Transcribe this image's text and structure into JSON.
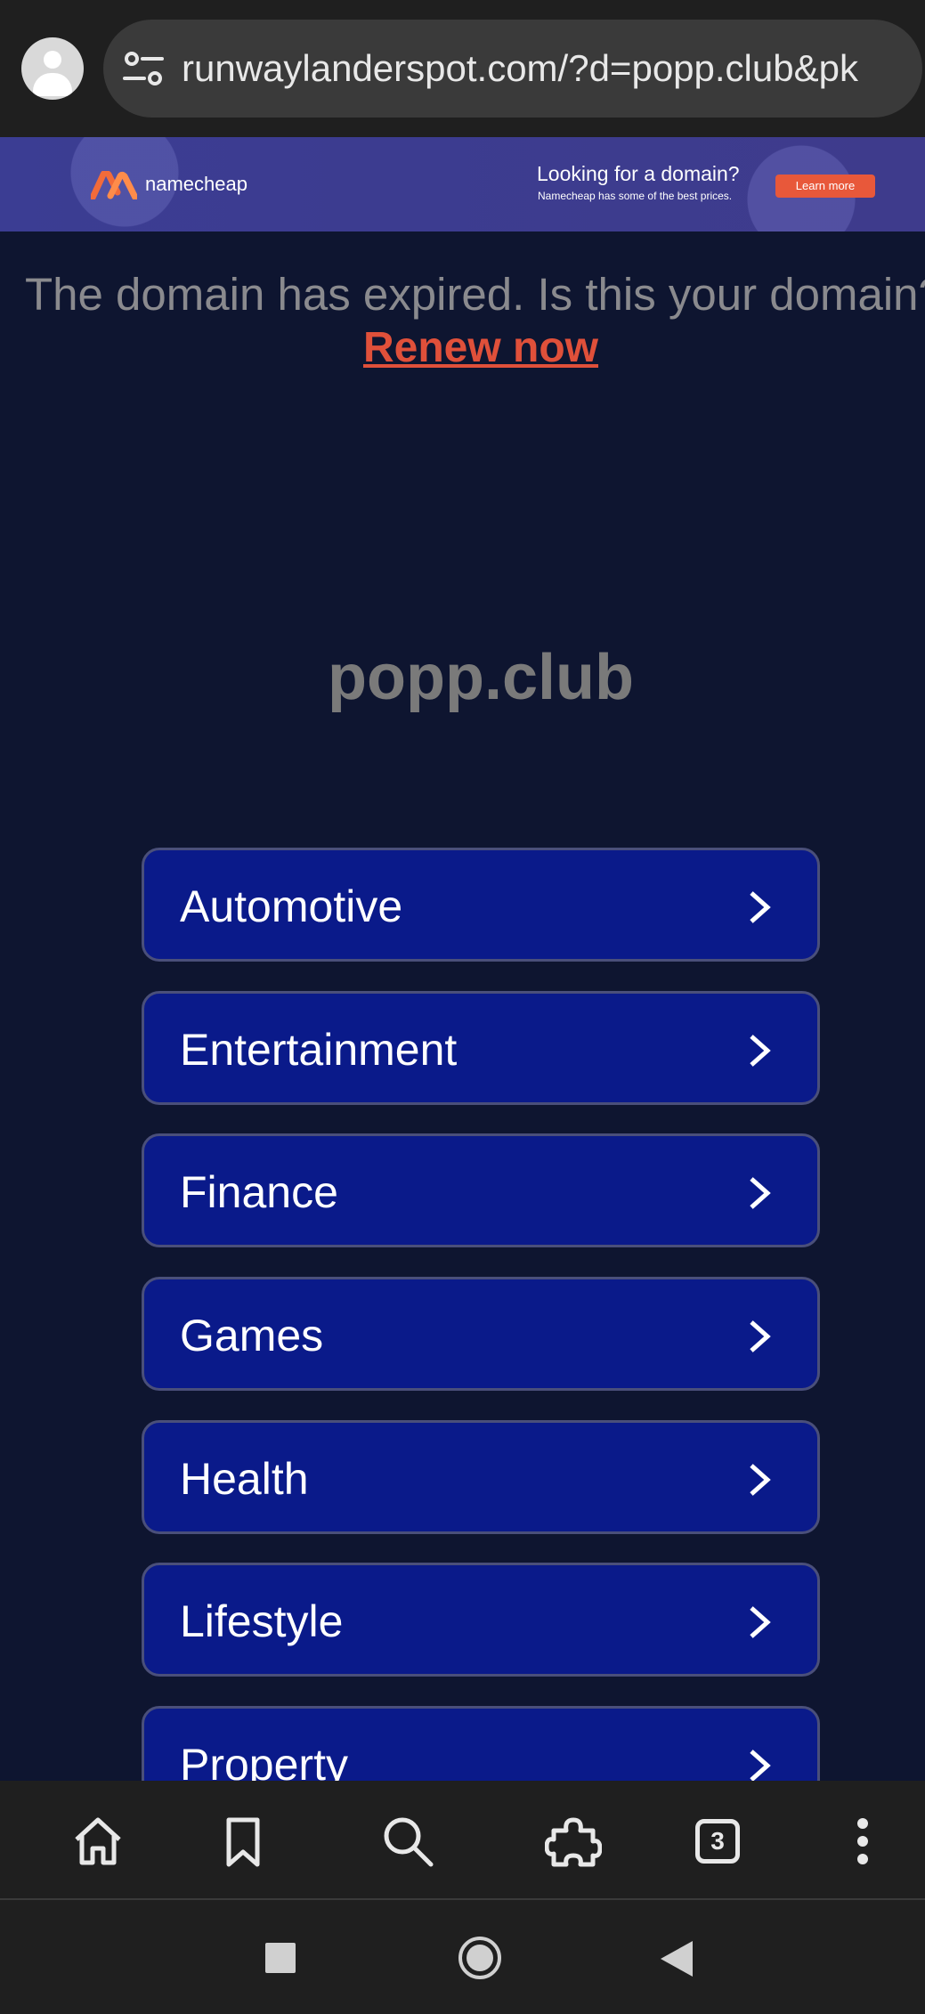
{
  "browser": {
    "url": "runwaylanderspot.com/?d=popp.club&pk",
    "tab_count": "3"
  },
  "ad": {
    "brand": "namecheap",
    "title": "Looking for a domain?",
    "subtitle": "Namecheap has some of the best prices.",
    "button": "Learn more",
    "accent_color": "#e8583a"
  },
  "notice": {
    "expired_text": "The domain has expired. Is this your domain?",
    "renew_link": "Renew now"
  },
  "site": {
    "title": "popp.club"
  },
  "categories": [
    {
      "label": "Automotive"
    },
    {
      "label": "Entertainment"
    },
    {
      "label": "Finance"
    },
    {
      "label": "Games"
    },
    {
      "label": "Health"
    },
    {
      "label": "Lifestyle"
    },
    {
      "label": "Property"
    }
  ],
  "bottom_nav": {
    "icons": [
      "home-icon",
      "bookmark-icon",
      "search-icon",
      "extensions-icon",
      "tabs-icon",
      "more-icon"
    ]
  },
  "system_nav": {
    "icons": [
      "recents-icon",
      "home-icon",
      "back-icon"
    ]
  }
}
